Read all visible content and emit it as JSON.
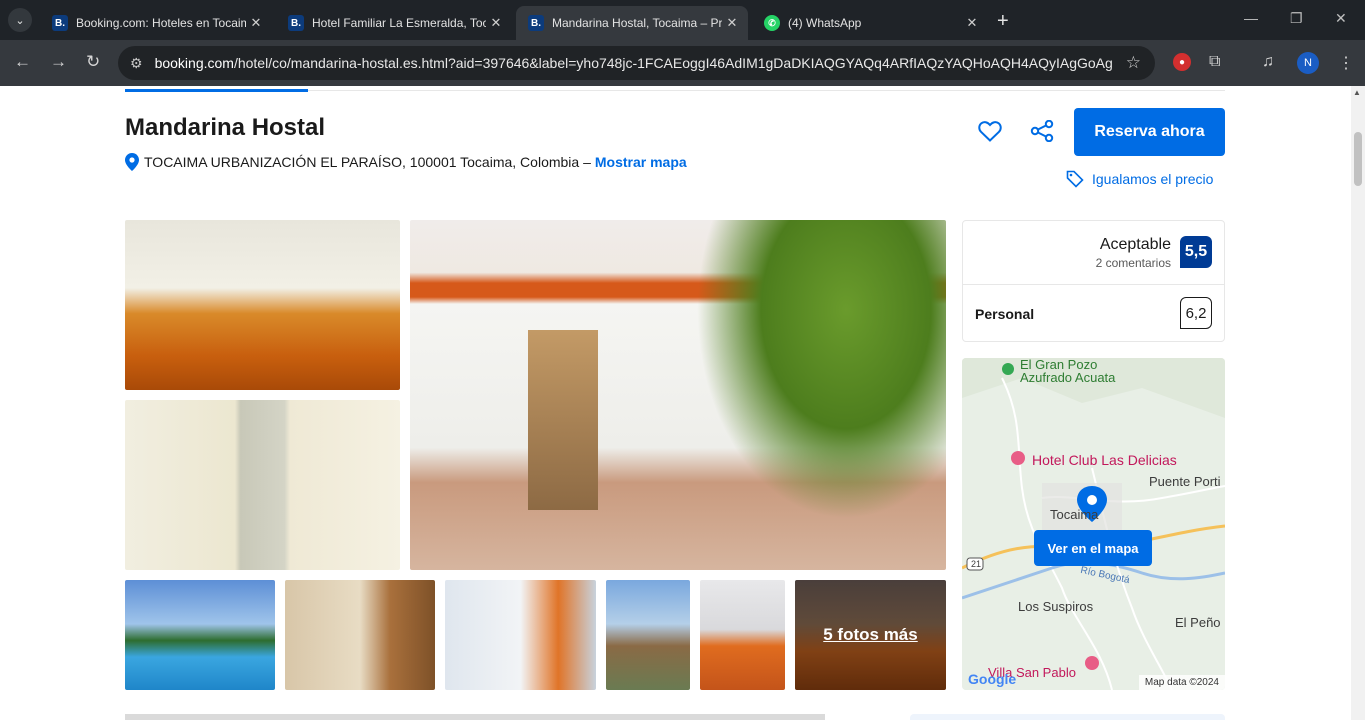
{
  "browser": {
    "tabs": [
      {
        "favicon": "B.",
        "title": "Booking.com: Hoteles en Tocaima"
      },
      {
        "favicon": "B.",
        "title": "Hotel Familiar La Esmeralda, Tocaima"
      },
      {
        "favicon": "B.",
        "title": "Mandarina Hostal, Tocaima – Precios"
      },
      {
        "favicon": "wa",
        "title": "(4) WhatsApp"
      }
    ],
    "url_domain": "booking.com",
    "url_rest": "/hotel/co/mandarina-hostal.es.html?aid=397646&label=yho748jc-1FCAEoggI46AdIM1gDaDKIAQGYAQq4ARfIAQzYAQHoAQH4AQyIAgGoAg...",
    "profile_initial": "N"
  },
  "hotel": {
    "name": "Mandarina Hostal",
    "address": "TOCAIMA URBANIZACIÓN EL PARAÍSO, 100001 Tocaima, Colombia –",
    "show_map": "Mostrar mapa",
    "reserve": "Reserva ahora",
    "price_match": "Igualamos el precio",
    "more_photos": "5 fotos más"
  },
  "rating": {
    "label": "Aceptable",
    "reviews": "2 comentarios",
    "score": "5,5",
    "sub_label": "Personal",
    "sub_score": "6,2"
  },
  "map": {
    "labels": {
      "pozo_1": "El Gran Pozo",
      "pozo_2": "Azufrado Acuata",
      "club": "Hotel Club Las Delicias",
      "puente": "Puente Porti",
      "tocaima": "Tocaima",
      "rio": "Río Bogotá",
      "suspiros": "Los Suspiros",
      "penon": "El Peño",
      "san_pablo": "Villa San Pablo",
      "route": "21"
    },
    "view_button": "Ver en el mapa",
    "copyright": "Map data ©2024",
    "google": "Google"
  },
  "colors": {
    "brand_blue": "#006ce4",
    "score_navy": "#003b95"
  }
}
